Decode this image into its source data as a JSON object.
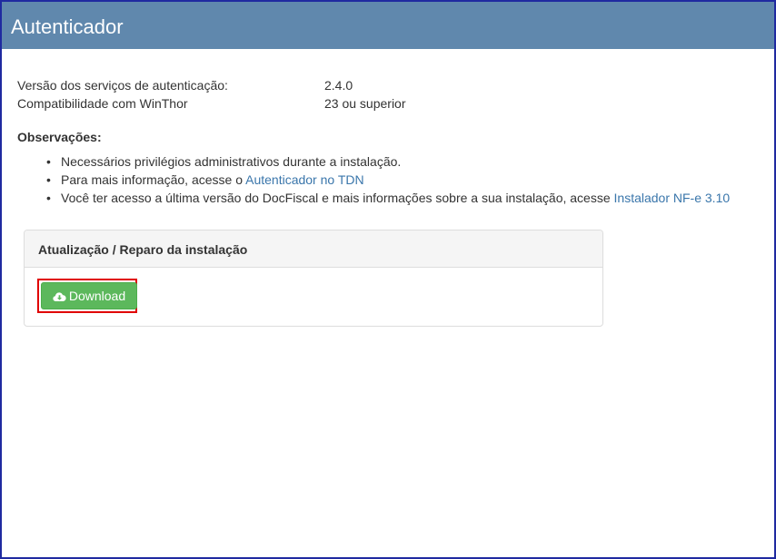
{
  "header": {
    "title": "Autenticador"
  },
  "info": {
    "version_label": "Versão dos serviços de autenticação:",
    "version_value": "2.4.0",
    "compat_label": "Compatibilidade com WinThor",
    "compat_value": "23 ou superior"
  },
  "observations": {
    "title": "Observações:",
    "items": [
      {
        "text": "Necessários privilégios administrativos durante a instalação."
      },
      {
        "text": "Para mais informação, acesse o ",
        "link": "Autenticador no TDN"
      },
      {
        "text": "Você ter acesso a última versão do DocFiscal e mais informações sobre a sua instalação, acesse ",
        "link": "Instalador NF-e 3.10"
      }
    ]
  },
  "panel": {
    "title": "Atualização / Reparo da instalação",
    "download_label": "Download",
    "download_icon": "cloud-download-icon"
  },
  "colors": {
    "header_bg": "#6088ad",
    "link": "#3a76ab",
    "button_bg": "#5cb85c",
    "highlight_border": "#e00000",
    "frame_border": "#1f2aa0"
  }
}
